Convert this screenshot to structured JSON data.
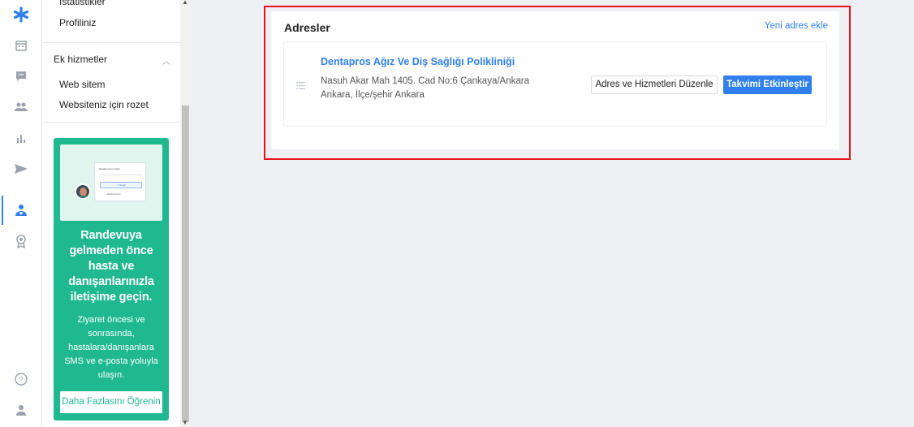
{
  "sidebar": {
    "items_top": [
      "İstatistikler",
      "Profiliniz"
    ],
    "section": "Ek hizmetler",
    "section_items": [
      "Web sitem",
      "Websiteniz için rozet"
    ]
  },
  "promo": {
    "illustration_card": {
      "title": "Randevunuz onaylı",
      "confirm": "✓ Onaylı",
      "edit": "İptal/Düzenle"
    },
    "title": "Randevuya gelmeden önce hasta ve danışanlarınızla iletişime geçin.",
    "text": "Ziyaret öncesi ve sonrasında, hastalara/danışanlara SMS ve e-posta yoluyla ulaşın.",
    "button": "Daha Fazlasını Öğrenin"
  },
  "main": {
    "card_title": "Adresler",
    "add_link": "Yeni adres ekle",
    "address": {
      "name": "Dentapros Ağız Ve Diş Sağlığı Polikliniği",
      "line1": "Nasuh Akar Mah 1405. Cad No:6 Çankaya/Ankara",
      "line2": "Ankara, İlçe/şehir Ankara",
      "edit_button": "Adres ve Hizmetleri Düzenle",
      "activate_button": "Takvimi Etkinleştir"
    }
  },
  "colors": {
    "accent": "#2f80ed",
    "promo": "#1fb88f",
    "highlight": "#e8141b"
  }
}
